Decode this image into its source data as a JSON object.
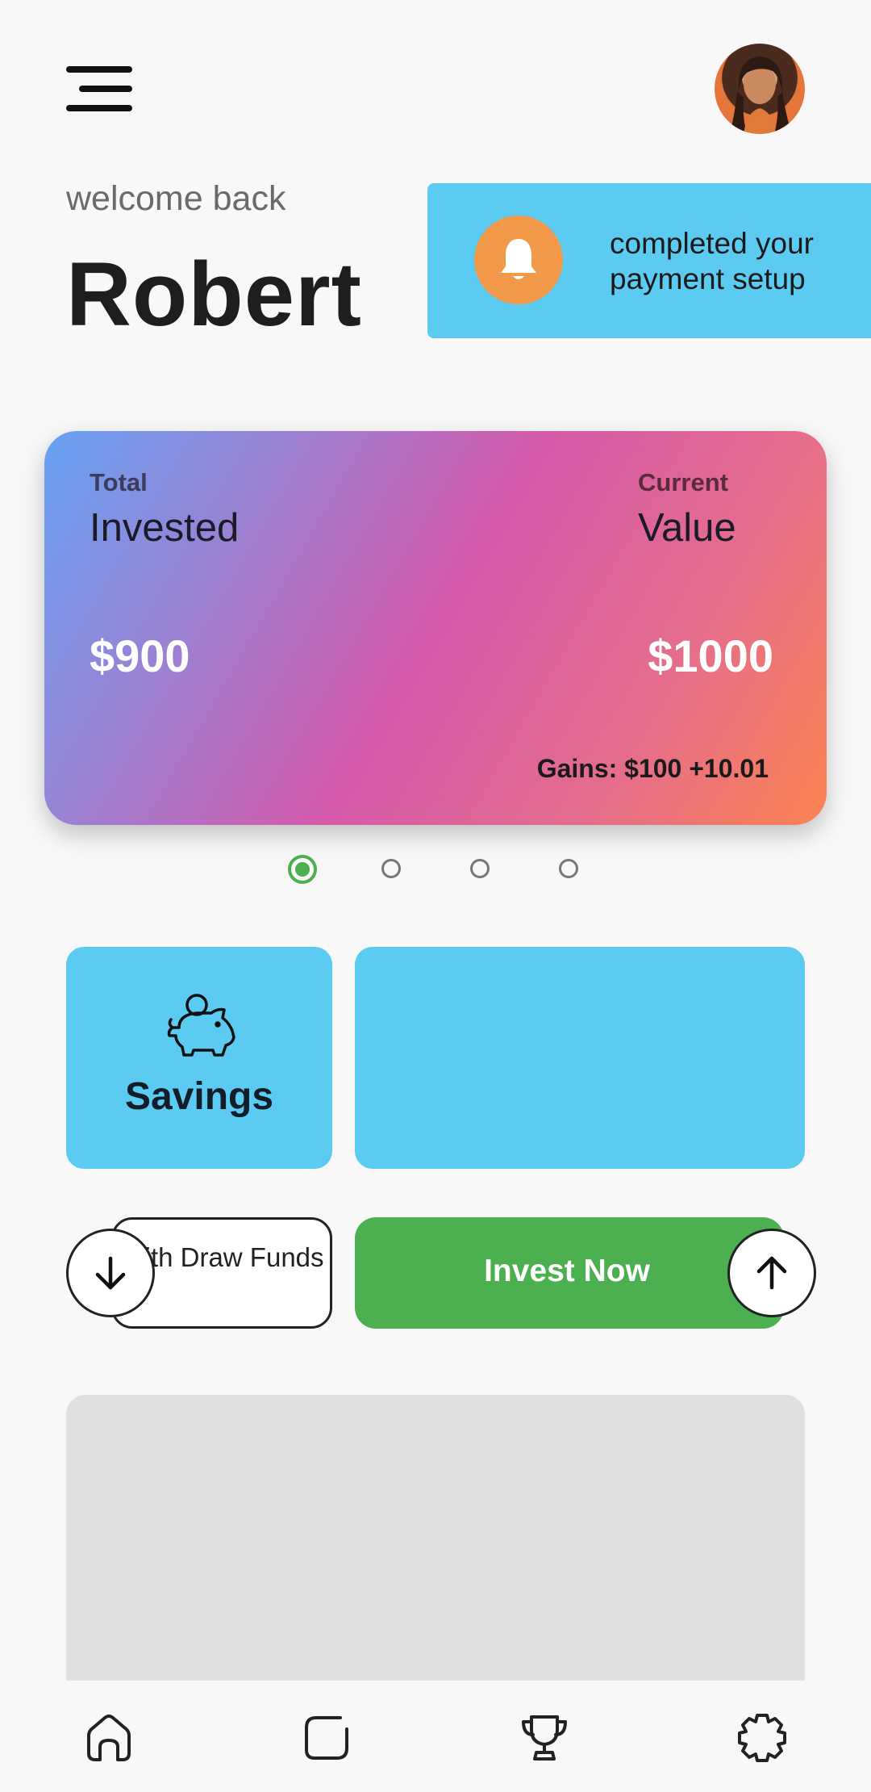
{
  "header": {
    "menu_icon": "hamburger-menu-icon",
    "avatar_icon": "user-avatar"
  },
  "greeting": {
    "welcome": "welcome back",
    "name": "Robert"
  },
  "notification": {
    "icon": "bell-icon",
    "message": "completed your payment setup",
    "colors": {
      "background": "#5bcbf1",
      "icon_bg": "#f2994a"
    }
  },
  "portfolio_card": {
    "left_small": "Total",
    "left_big": "Invested",
    "right_small": "Current",
    "right_big": "Value",
    "invested_amount": "$900",
    "current_amount": "$1000",
    "gains": "Gains: $100 +10.01"
  },
  "carousel": {
    "page_count": 4,
    "active_index": 0,
    "active_color": "#4caf50"
  },
  "tiles": {
    "savings_label": "Savings",
    "savings_icon": "piggy-bank-icon",
    "tile_color": "#5bcbf1"
  },
  "actions": {
    "withdraw_label": "With Draw Funds",
    "withdraw_icon": "arrow-down-icon",
    "invest_label": "Invest Now",
    "invest_icon": "arrow-up-icon",
    "invest_color": "#4caf50"
  },
  "bottom_nav": {
    "items": [
      "home-icon",
      "square-icon",
      "trophy-icon",
      "settings-gear-icon"
    ]
  }
}
